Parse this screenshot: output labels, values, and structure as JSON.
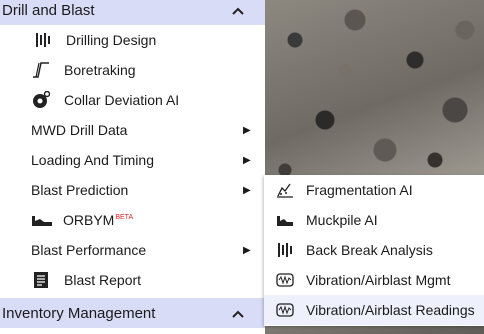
{
  "sections": {
    "drill_and_blast": {
      "label": "Drill and Blast",
      "chevron": "chevron-up-icon"
    },
    "inventory": {
      "label": "Inventory Management",
      "chevron": "chevron-up-icon"
    }
  },
  "menu_items": [
    {
      "label": "Drilling Design",
      "icon": "drilling-design-icon"
    },
    {
      "label": "Boretraking",
      "icon": "boretracking-icon"
    },
    {
      "label": "Collar Deviation AI",
      "icon": "collar-deviation-icon"
    },
    {
      "label": "MWD Drill Data",
      "has_arrow": true
    },
    {
      "label": "Loading And Timing",
      "has_arrow": true
    },
    {
      "label": "Blast Prediction",
      "has_arrow": true
    },
    {
      "label": "ORBYM",
      "badge": "BETA",
      "icon": "orbym-icon"
    },
    {
      "label": "Blast Performance",
      "has_arrow": true
    },
    {
      "label": "Blast Report",
      "icon": "report-icon"
    }
  ],
  "submenu": [
    {
      "label": "Fragmentation AI",
      "icon": "fragmentation-icon"
    },
    {
      "label": "Muckpile AI",
      "icon": "muckpile-icon"
    },
    {
      "label": "Back Break Analysis",
      "icon": "backbreak-icon"
    },
    {
      "label": "Vibration/Airblast Mgmt",
      "icon": "vibration-icon"
    },
    {
      "label": "Vibration/Airblast Readings",
      "icon": "vibration-readings-icon",
      "highlighted": true
    }
  ]
}
